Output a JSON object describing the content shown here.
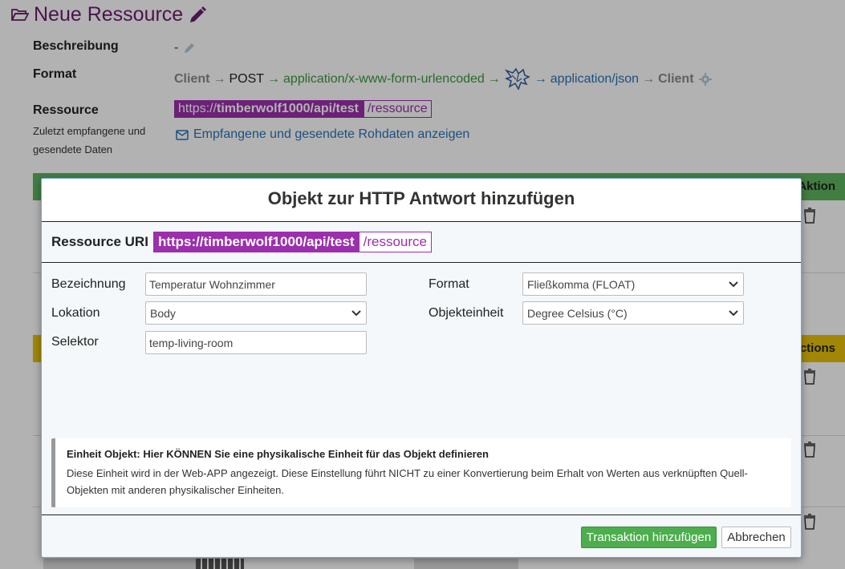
{
  "page": {
    "title": "Neue Ressource",
    "beschreibung_label": "Beschreibung",
    "beschreibung_value": "-",
    "format_label": "Format",
    "format_chain": {
      "client1": "Client",
      "method": "POST",
      "request_type": "application/x-www-form-urlencoded",
      "response_type": "application/json",
      "client2": "Client"
    },
    "ressource_label": "Ressource",
    "ressource_sub": "Zuletzt empfangene und gesendete Daten",
    "uri_base_prefix": "https://",
    "uri_base_bold": "timberwolf1000/api/test",
    "uri_path": "/ressource",
    "raw_link": "Empfangene und gesendete Rohdaten anzeigen",
    "table1_action": "Aktion",
    "table2_action": "Actions"
  },
  "modal": {
    "title": "Objekt zur HTTP Antwort hinzufügen",
    "uri_label": "Ressource URI",
    "uri_base": "https://timberwolf1000/api/test",
    "uri_path": "/ressource",
    "fields": {
      "bezeichnung_label": "Bezeichnung",
      "bezeichnung_value": "Temperatur Wohnzimmer",
      "lokation_label": "Lokation",
      "lokation_value": "Body",
      "selektor_label": "Selektor",
      "selektor_value": "temp-living-room",
      "format_label": "Format",
      "format_value": "Fließkomma (FLOAT)",
      "objekteinheit_label": "Objekteinheit",
      "objekteinheit_value": "Degree Celsius (°C)"
    },
    "info": {
      "title": "Einheit Objekt: Hier KÖNNEN Sie eine physikalische Einheit für das Objekt definieren",
      "text": "Diese Einheit wird in der Web-APP angezeigt. Diese Einstellung führt NICHT zu einer Konvertierung beim Erhalt von Werten aus verknüpften Quell-Objekten mit anderen physikalischer Einheiten."
    },
    "buttons": {
      "primary": "Transaktion hinzufügen",
      "cancel": "Abbrechen"
    }
  },
  "colors": {
    "accent_purple": "#9b2fad",
    "title_purple": "#6b1e6f",
    "success_green": "#4cae4c",
    "link_blue": "#2a72b8"
  }
}
